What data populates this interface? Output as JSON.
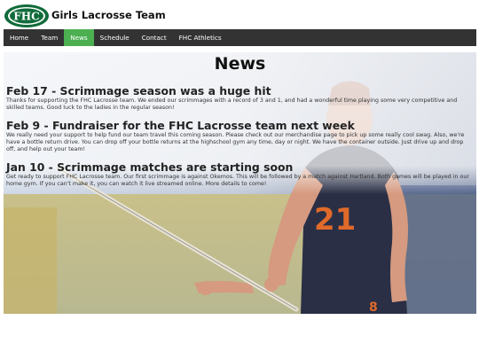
{
  "header": {
    "logo_text": "FHC",
    "site_title": "Girls Lacrosse Team"
  },
  "nav": {
    "items": [
      {
        "label": "Home"
      },
      {
        "label": "Team"
      },
      {
        "label": "News",
        "active": true
      },
      {
        "label": "Schedule"
      },
      {
        "label": "Contact"
      },
      {
        "label": "FHC Athletics"
      }
    ]
  },
  "main": {
    "page_title": "News",
    "articles": [
      {
        "title": "Feb 17 - Scrimmage season was a huge hit",
        "body": "Thanks for supporting the FHC Lacrosse team. We ended our scrimmages with a record of 3 and 1, and had a wonderful time playing some very competitive and skilled teams. Good luck to the ladies in the regular season!"
      },
      {
        "title": "Feb 9 - Fundraiser for the FHC Lacrosse team next week",
        "body": "We really need your support to help fund our team travel this coming season. Please check out our merchandise page to pick up some really cool swag. Also, we're have a bottle return drive. You can drop off your bottle returns at the highschool gym any time, day or night. We have the container outside. Just drive up and drop off, and help out your team!"
      },
      {
        "title": "Jan 10 - Scrimmage matches are starting soon",
        "body": "Get ready to support FHC Lacrosse team. Our first scrimmage is against Okemos. This will be followed by a match against Hartland. Both games will be played in our home gym. If you can't make it, you can watch it live streamed online. More details to come!"
      }
    ]
  },
  "colors": {
    "nav_bg": "#333333",
    "nav_active": "#4caf50",
    "logo_green": "#0f6b3a"
  }
}
